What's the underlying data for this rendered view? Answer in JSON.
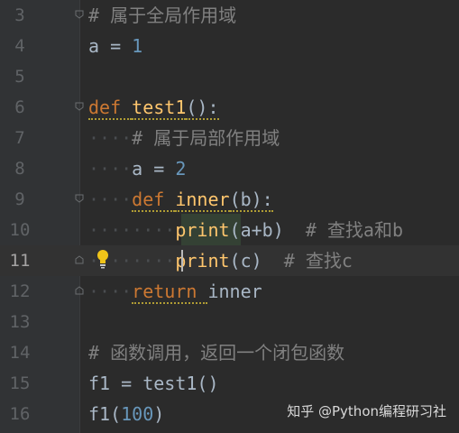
{
  "editor": {
    "lines": [
      {
        "n": "3",
        "segs": [
          {
            "c": "cm",
            "t": "# 属于全局作用域"
          }
        ]
      },
      {
        "n": "4",
        "segs": [
          {
            "c": "ident",
            "t": "a = "
          },
          {
            "c": "num",
            "t": "1"
          }
        ]
      },
      {
        "n": "5",
        "segs": []
      },
      {
        "n": "6",
        "segs": [
          {
            "c": "kw",
            "t": "def "
          },
          {
            "c": "fn",
            "t": "test1"
          },
          {
            "c": "ident",
            "t": "():"
          }
        ]
      },
      {
        "n": "7",
        "segs": [
          {
            "c": "dot",
            "t": "····"
          },
          {
            "c": "cm",
            "t": "# 属于局部作用域"
          }
        ]
      },
      {
        "n": "8",
        "segs": [
          {
            "c": "dot",
            "t": "····"
          },
          {
            "c": "ident",
            "t": "a = "
          },
          {
            "c": "num",
            "t": "2"
          }
        ]
      },
      {
        "n": "9",
        "segs": [
          {
            "c": "dot",
            "t": "····"
          },
          {
            "c": "kw",
            "t": "def "
          },
          {
            "c": "fn",
            "t": "inner"
          },
          {
            "c": "ident",
            "t": "(b):"
          }
        ]
      },
      {
        "n": "10",
        "segs": [
          {
            "c": "dot",
            "t": "········"
          },
          {
            "c": "fn",
            "t": "print"
          },
          {
            "c": "ident",
            "t": "(a+b)  "
          },
          {
            "c": "cm",
            "t": "# 查找a和b"
          }
        ]
      },
      {
        "n": "11",
        "segs": [
          {
            "c": "dot",
            "t": "········"
          },
          {
            "c": "fn",
            "t": "print"
          },
          {
            "c": "ident",
            "t": "(c)  "
          },
          {
            "c": "cm",
            "t": "# 查找c"
          }
        ]
      },
      {
        "n": "12",
        "segs": [
          {
            "c": "dot",
            "t": "····"
          },
          {
            "c": "kw",
            "t": "return "
          },
          {
            "c": "ident",
            "t": "inner"
          }
        ]
      },
      {
        "n": "13",
        "segs": []
      },
      {
        "n": "14",
        "segs": [
          {
            "c": "cm",
            "t": "# 函数调用，返回一个闭包函数"
          }
        ]
      },
      {
        "n": "15",
        "segs": [
          {
            "c": "ident",
            "t": "f1 = test1()"
          }
        ]
      },
      {
        "n": "16",
        "segs": [
          {
            "c": "ident",
            "t": "f1("
          },
          {
            "c": "num",
            "t": "100"
          },
          {
            "c": "ident",
            "t": ")"
          }
        ]
      }
    ],
    "current_line": "11"
  },
  "watermark": "知乎 @Python编程研习社",
  "colors": {
    "background": "#2b2b2b",
    "gutter": "#313335",
    "keyword": "#cc7832",
    "function": "#ffc66d",
    "number": "#6897bb",
    "comment": "#808080",
    "identifier": "#a9b7c6"
  },
  "icons": [
    "fold-marker-icon",
    "lightbulb-icon"
  ]
}
